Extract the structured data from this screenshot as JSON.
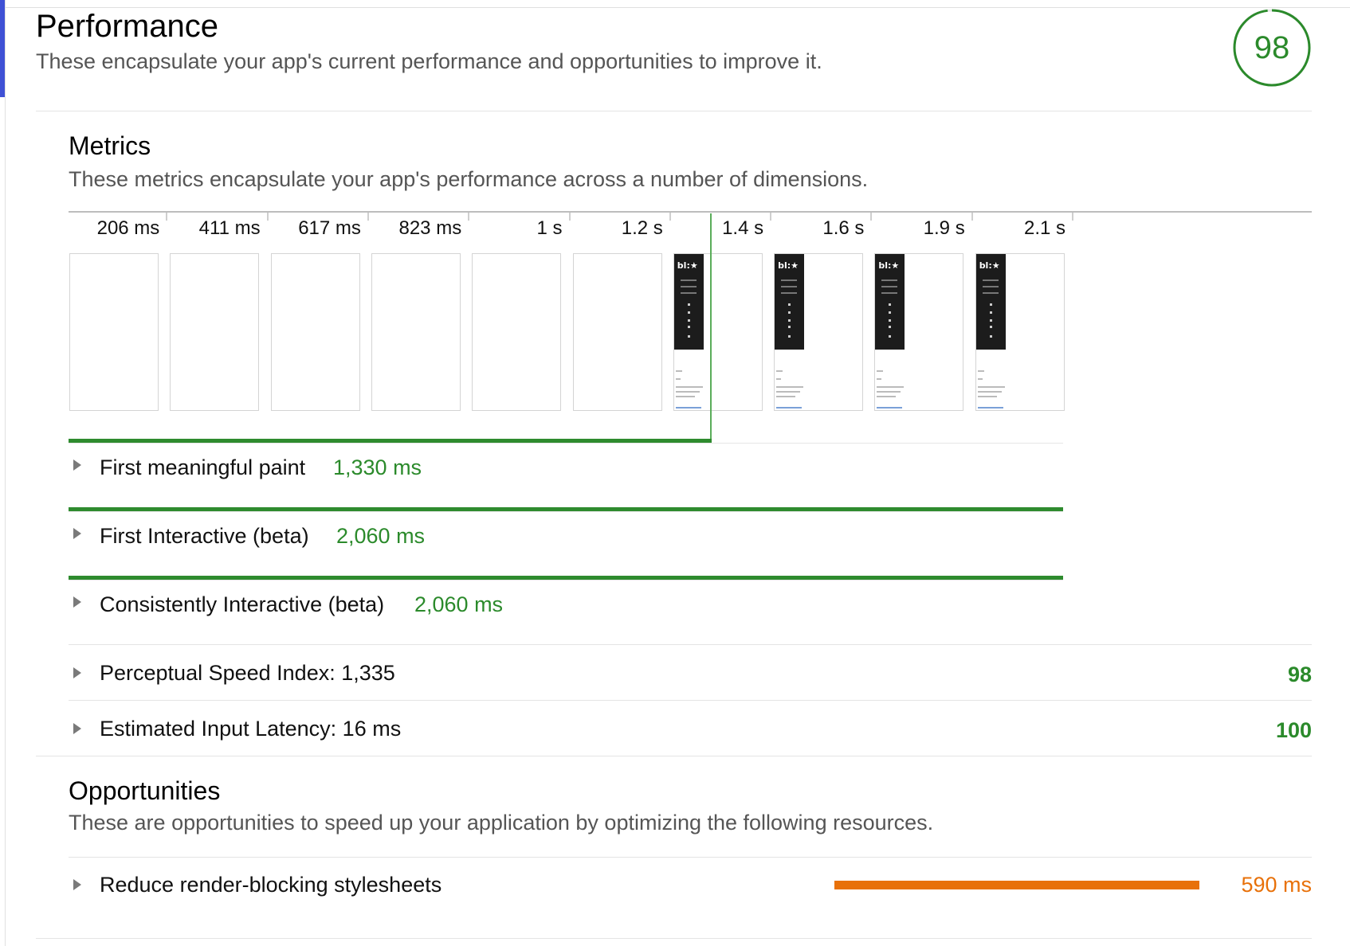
{
  "header": {
    "title": "Performance",
    "subtitle": "These encapsulate your app's current performance and opportunities to improve it.",
    "score": "98",
    "score_fraction": 0.98,
    "accent_color": "#3f51d5",
    "score_color": "#2b8a2b"
  },
  "metrics": {
    "title": "Metrics",
    "description": "These metrics encapsulate your app's performance across a number of dimensions.",
    "timeline_ticks": [
      "206 ms",
      "411 ms",
      "617 ms",
      "823 ms",
      "1 s",
      "1.2 s",
      "1.4 s",
      "1.6 s",
      "1.9 s",
      "2.1 s"
    ],
    "filmstrip": [
      {
        "rendered": false
      },
      {
        "rendered": false
      },
      {
        "rendered": false
      },
      {
        "rendered": false
      },
      {
        "rendered": false
      },
      {
        "rendered": false
      },
      {
        "rendered": true
      },
      {
        "rendered": true
      },
      {
        "rendered": true
      },
      {
        "rendered": true
      }
    ],
    "thumbnail_logo": "bl:★",
    "timeline_max_ms": 2060,
    "items": [
      {
        "label": "First meaningful paint",
        "value": "1,330 ms",
        "value_ms": 1330
      },
      {
        "label": "First Interactive (beta)",
        "value": "2,060 ms",
        "value_ms": 2060
      },
      {
        "label": "Consistently Interactive (beta)",
        "value": "2,060 ms",
        "value_ms": 2060
      }
    ],
    "scored_items": [
      {
        "label": "Perceptual Speed Index: 1,335",
        "score": "98"
      },
      {
        "label": "Estimated Input Latency: 16 ms",
        "score": "100"
      }
    ],
    "good_color": "#2b8a2b"
  },
  "opportunities": {
    "title": "Opportunities",
    "description": "These are opportunities to speed up your application by optimizing the following resources.",
    "items": [
      {
        "label": "Reduce render-blocking stylesheets",
        "value": "590 ms"
      }
    ],
    "warn_color": "#e8710a"
  }
}
